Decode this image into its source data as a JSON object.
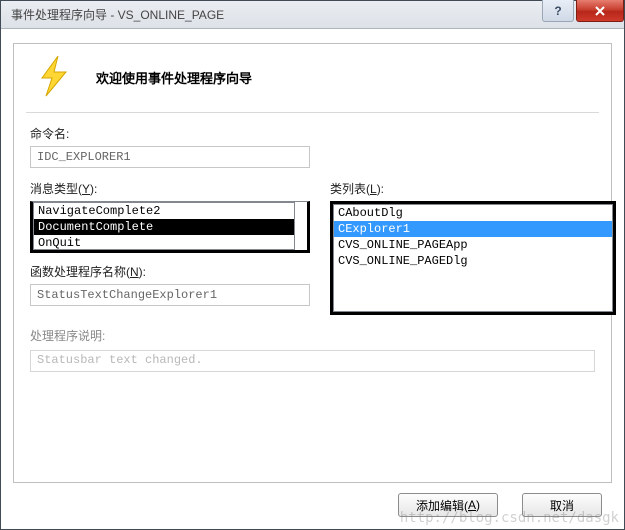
{
  "window": {
    "title": "事件处理程序向导 - VS_ONLINE_PAGE"
  },
  "wizard": {
    "heading": "欢迎使用事件处理程序向导"
  },
  "labels": {
    "command_name": "命令名:",
    "message_type": "消息类型(",
    "message_type_key": "Y",
    "message_type_close": "):",
    "class_list": "类列表(",
    "class_list_key": "L",
    "class_list_close": "):",
    "handler_name": "函数处理程序名称(",
    "handler_name_key": "N",
    "handler_name_close": "):",
    "handler_desc": "处理程序说明:"
  },
  "fields": {
    "command_name_value": "IDC_EXPLORER1",
    "handler_name_value": "StatusTextChangeExplorer1",
    "handler_desc_value": "Statusbar text changed."
  },
  "message_types": {
    "items": [
      {
        "label": "NavigateComplete2"
      },
      {
        "label": "DocumentComplete"
      },
      {
        "label": "OnQuit"
      }
    ],
    "selected_index": 1
  },
  "class_list": {
    "items": [
      {
        "label": "CAboutDlg"
      },
      {
        "label": "CExplorer1"
      },
      {
        "label": "CVS_ONLINE_PAGEApp"
      },
      {
        "label": "CVS_ONLINE_PAGEDlg"
      }
    ],
    "selected_index": 1
  },
  "buttons": {
    "add_edit": "添加编辑(",
    "add_edit_key": "A",
    "add_edit_close": ")",
    "cancel": "取消"
  },
  "watermark": "http://blog.csdn.net/dasgk"
}
